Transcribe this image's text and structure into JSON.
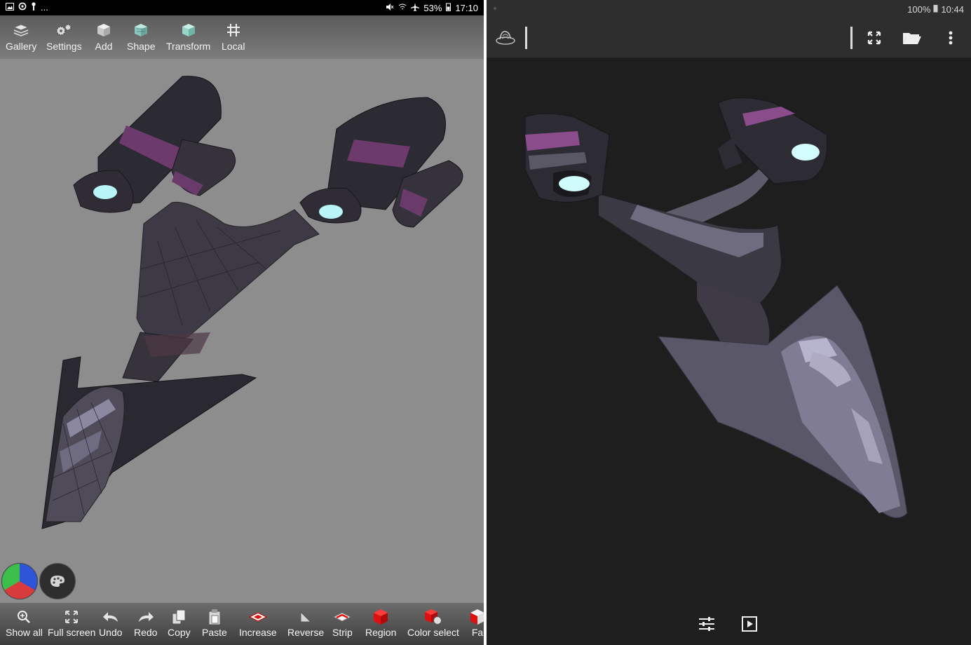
{
  "left": {
    "status": {
      "icons_left": [
        "image-icon",
        "sync-icon",
        "key-icon"
      ],
      "more": "...",
      "battery": "53%",
      "time": "17:10"
    },
    "top_toolbar": [
      {
        "label": "Gallery",
        "icon": "layers-icon"
      },
      {
        "label": "Settings",
        "icon": "gears-icon"
      },
      {
        "label": "Add",
        "icon": "cube-icon"
      },
      {
        "label": "Shape",
        "icon": "shape-cube-icon"
      },
      {
        "label": "Transform",
        "icon": "transform-cube-icon"
      },
      {
        "label": "Local",
        "icon": "local-axis-icon"
      }
    ],
    "bottom_toolbar": [
      {
        "label": "Show all",
        "icon": "zoom-icon"
      },
      {
        "label": "Full screen",
        "icon": "fullscreen-icon"
      },
      {
        "label": "Undo",
        "icon": "undo-icon"
      },
      {
        "label": "Redo",
        "icon": "redo-icon"
      },
      {
        "label": "Copy",
        "icon": "copy-icon"
      },
      {
        "label": "Paste",
        "icon": "paste-icon"
      },
      {
        "label": "Increase",
        "icon": "increase-icon"
      },
      {
        "label": "Reverse",
        "icon": "reverse-icon"
      },
      {
        "label": "Strip",
        "icon": "strip-icon"
      },
      {
        "label": "Region",
        "icon": "region-cube-icon"
      },
      {
        "label": "Color select",
        "icon": "color-select-icon"
      },
      {
        "label": "Fa",
        "icon": "face-icon"
      }
    ],
    "colors": {
      "viewport_bg": "#8d8d8d",
      "accent_red": "#e01010"
    }
  },
  "right": {
    "status": {
      "battery": "100%",
      "time": "10:44"
    },
    "topbar": {
      "icons": [
        "app-logo-icon",
        "fullscreen-icon",
        "folder-icon",
        "more-vert-icon"
      ]
    },
    "bottombar": {
      "icons": [
        "sliders-icon",
        "play-icon"
      ]
    },
    "colors": {
      "viewport_bg": "#1e1e1e"
    }
  }
}
